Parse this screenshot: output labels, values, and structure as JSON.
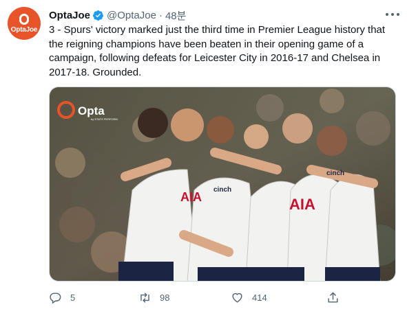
{
  "tweet": {
    "avatar_text": "OptaJoe",
    "display_name": "OptaJoe",
    "handle": "@OptaJoe",
    "separator": "·",
    "time": "48분",
    "text": "3 - Spurs' victory marked just the third time in Premier League history that the reigning champions have been beaten in their opening game of a campaign, following defeats for Leicester City in 2016-17 and Chelsea in 2017-18. Grounded.",
    "media": {
      "watermark": "Opta",
      "watermark_sub": "by STATS PERFORM",
      "sponsor_1": "cinch",
      "sponsor_2": "AIA",
      "sponsor_3": "AIA",
      "sponsor_4": "cinch"
    },
    "stats": {
      "replies": "5",
      "retweets": "98",
      "likes": "414"
    }
  },
  "colors": {
    "avatar_bg": "#e8542a",
    "verified": "#1d9bf0",
    "text": "#0f1419",
    "secondary": "#536471"
  },
  "icons": [
    "verified-icon",
    "more-icon",
    "reply-icon",
    "retweet-icon",
    "like-icon",
    "share-icon"
  ]
}
